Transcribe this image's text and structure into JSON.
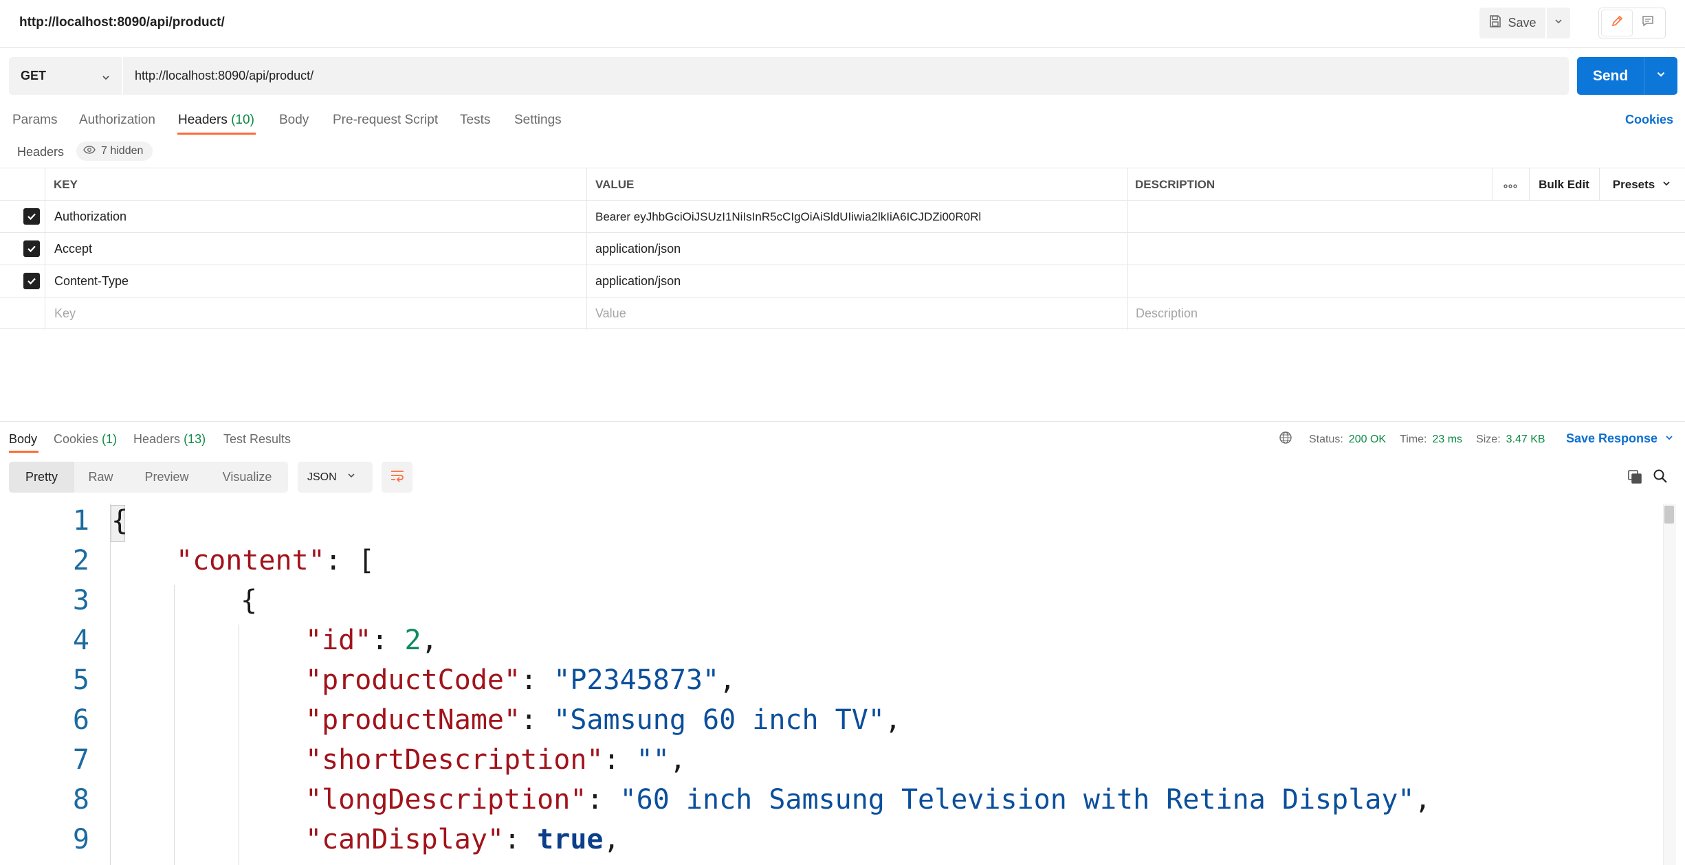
{
  "tab": {
    "title": "http://localhost:8090/api/product/"
  },
  "toolbar": {
    "save_label": "Save"
  },
  "request": {
    "method": "GET",
    "url": "http://localhost:8090/api/product/",
    "send_label": "Send"
  },
  "request_tabs": {
    "params": "Params",
    "authorization": "Authorization",
    "headers": "Headers",
    "headers_count": "(10)",
    "body": "Body",
    "prerequest": "Pre-request Script",
    "tests": "Tests",
    "settings": "Settings",
    "cookies": "Cookies"
  },
  "headers_section": {
    "label": "Headers",
    "hidden": "7 hidden"
  },
  "headers_table": {
    "columns": {
      "key": "KEY",
      "value": "VALUE",
      "description": "DESCRIPTION",
      "bulk_edit": "Bulk Edit",
      "presets": "Presets"
    },
    "rows": [
      {
        "key": "Authorization",
        "value": "Bearer eyJhbGciOiJSUzI1NiIsInR5cCIgOiAiSldUIiwia2lkIiA6ICJDZi00R0Rl",
        "description": ""
      },
      {
        "key": "Accept",
        "value": "application/json",
        "description": ""
      },
      {
        "key": "Content-Type",
        "value": "application/json",
        "description": ""
      }
    ],
    "placeholders": {
      "key": "Key",
      "value": "Value",
      "description": "Description"
    }
  },
  "response_tabs": {
    "body": "Body",
    "cookies": "Cookies",
    "cookies_count": "(1)",
    "headers": "Headers",
    "headers_count": "(13)",
    "test_results": "Test Results"
  },
  "response_meta": {
    "status_label": "Status:",
    "status_value": "200 OK",
    "time_label": "Time:",
    "time_value": "23 ms",
    "size_label": "Size:",
    "size_value": "3.47 KB",
    "save_response": "Save Response"
  },
  "view_modes": {
    "pretty": "Pretty",
    "raw": "Raw",
    "preview": "Preview",
    "visualize": "Visualize",
    "format": "JSON"
  },
  "code": {
    "line_numbers": [
      "1",
      "2",
      "3",
      "4",
      "5",
      "6",
      "7",
      "8",
      "9"
    ],
    "l1_open": "{",
    "l2_key": "\"content\"",
    "l2_rest": ": [",
    "l3_open": "{",
    "l4_key": "\"id\"",
    "l4_sep": ": ",
    "l4_val": "2",
    "l4_end": ",",
    "l5_key": "\"productCode\"",
    "l5_sep": ": ",
    "l5_val": "\"P2345873\"",
    "l5_end": ",",
    "l6_key": "\"productName\"",
    "l6_sep": ": ",
    "l6_val": "\"Samsung 60 inch TV\"",
    "l6_end": ",",
    "l7_key": "\"shortDescription\"",
    "l7_sep": ": ",
    "l7_val": "\"\"",
    "l7_end": ",",
    "l8_key": "\"longDescription\"",
    "l8_sep": ": ",
    "l8_val": "\"60 inch Samsung Television with Retina Display\"",
    "l8_end": ",",
    "l9_key": "\"canDisplay\"",
    "l9_sep": ": ",
    "l9_val": "true",
    "l9_end": ","
  },
  "colors": {
    "accent_orange": "#ff6c37",
    "send_blue": "#0d76d9",
    "link_blue": "#0d6fcf",
    "count_green": "#0d8a45",
    "json_key": "#a1131b",
    "json_string": "#0b4f9c",
    "json_number": "#0f8a5f"
  },
  "icons": [
    "save-icon",
    "chevron-down-icon",
    "pencil-icon",
    "comment-icon",
    "eye-icon",
    "more-icon",
    "globe-icon",
    "wrap-lines-icon",
    "copy-icon",
    "search-icon",
    "checkbox-checked-icon"
  ]
}
